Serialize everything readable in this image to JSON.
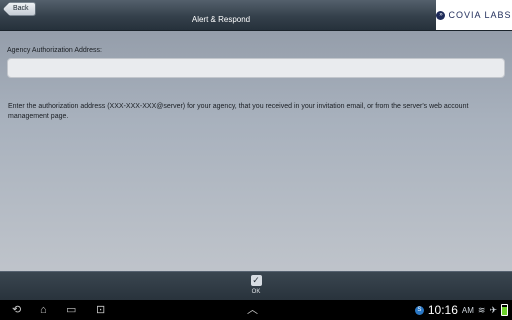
{
  "header": {
    "back_label": "Back",
    "title": "Alert & Respond",
    "logo_text": "COVIA LABS"
  },
  "form": {
    "address_label": "Agency Authorization Address:",
    "address_value": "",
    "address_placeholder": "",
    "help_text": "Enter the authorization address (XXX-XXX-XXX@server) for your agency, that you received in your invitation email, or from the server's web account management page."
  },
  "footer": {
    "ok_label": "OK"
  },
  "system_bar": {
    "time": "10:16",
    "am_pm": "AM",
    "notification_icon": "skype-icon",
    "battery_color": "#6cd12c"
  }
}
